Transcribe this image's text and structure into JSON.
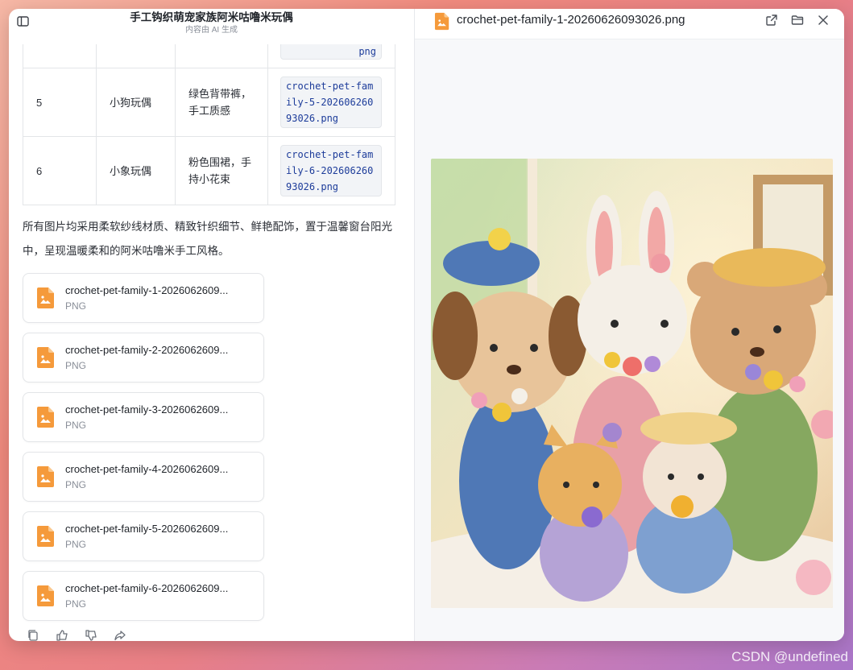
{
  "window": {
    "title": "手工钩织萌宠家族阿米咕噜米玩偶",
    "subtitle": "内容由 AI 生成"
  },
  "table": {
    "rows": [
      {
        "num": "",
        "name": "",
        "desc": "",
        "file": "png"
      },
      {
        "num": "5",
        "name": "小狗玩偶",
        "desc": "绿色背带裤，手工质感",
        "file": "crochet-pet-family-5-20260626093026.png"
      },
      {
        "num": "6",
        "name": "小象玩偶",
        "desc": "粉色围裙，手持小花束",
        "file": "crochet-pet-family-6-20260626093026.png"
      }
    ]
  },
  "paragraph": "所有图片均采用柔软纱线材质、精致针织细节、鲜艳配饰，置于温馨窗台阳光中，呈现温暖柔和的阿米咕噜米手工风格。",
  "files": [
    {
      "name": "crochet-pet-family-1-2026062609...",
      "type": "PNG"
    },
    {
      "name": "crochet-pet-family-2-2026062609...",
      "type": "PNG"
    },
    {
      "name": "crochet-pet-family-3-2026062609...",
      "type": "PNG"
    },
    {
      "name": "crochet-pet-family-4-2026062609...",
      "type": "PNG"
    },
    {
      "name": "crochet-pet-family-5-2026062609...",
      "type": "PNG"
    },
    {
      "name": "crochet-pet-family-6-2026062609...",
      "type": "PNG"
    }
  ],
  "preview": {
    "filename": "crochet-pet-family-1-20260626093026.png"
  },
  "colors": {
    "file_icon": "#f59a3b",
    "code_text": "#1d3c9a"
  },
  "watermark": "CSDN @undefined"
}
